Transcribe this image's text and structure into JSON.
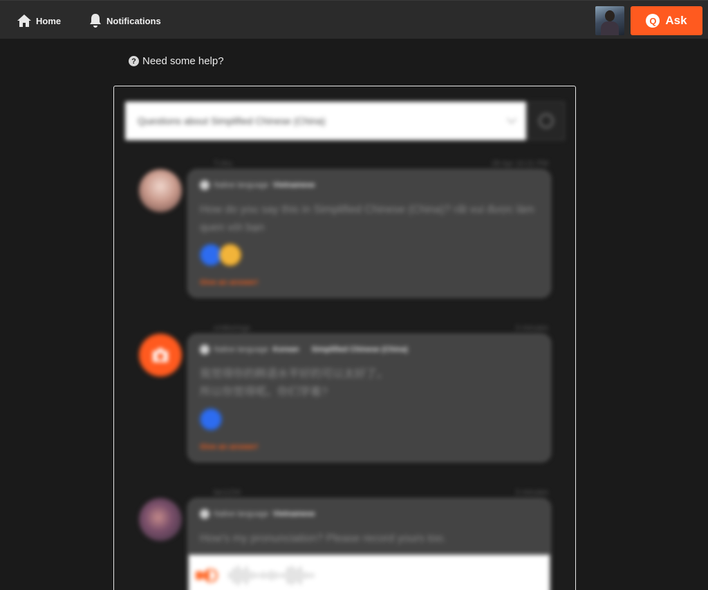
{
  "nav": {
    "home_label": "Home",
    "notifications_label": "Notifications",
    "ask_label": "Ask",
    "ask_icon_letter": "Q"
  },
  "help": {
    "label": "Need some help?",
    "icon_glyph": "?"
  },
  "filter": {
    "selected": "Questions about Simplified Chinese (China)"
  },
  "questions": [
    {
      "user": "T.nhu",
      "time": "28 Apr 10:21 PM",
      "native_label": "Native language",
      "native_value": "Vietnamese",
      "text": "How do you say this in Simplified Chinese (China)? rất vui được làm quen với bạn",
      "answer_link": "Give an answer!"
    },
    {
      "user": "cmtkorings",
      "time": "3 minutes",
      "native_label": "Native language",
      "native_value": "Korean",
      "studying_value": "Simplified Chinese (China)",
      "text": "我觉得你的韩语水平好的可以太好了。\n所以你觉得呢。你们学着?",
      "answer_link": "Give an answer!"
    },
    {
      "user": "lan1234",
      "time": "3 minutes",
      "native_label": "Native language",
      "native_value": "Vietnamese",
      "text": "How's my pronunciation? Please record yours too."
    }
  ],
  "colors": {
    "accent": "#ff5a1f",
    "topbar": "#2b2b2b",
    "background": "#1a1a1a",
    "card": "#444444",
    "link": "#e85a1c"
  }
}
